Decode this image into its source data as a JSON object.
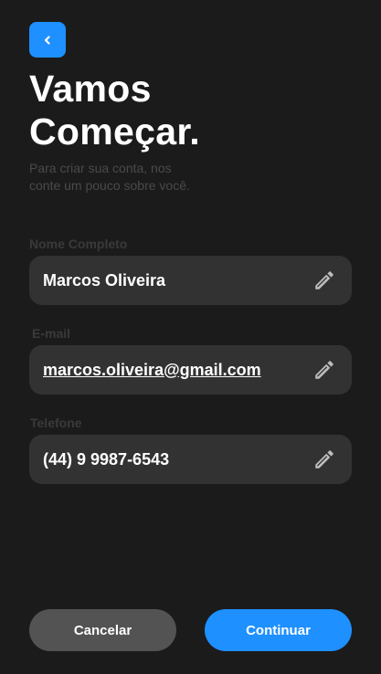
{
  "header": {
    "back_icon": "chevron-left-icon",
    "title_line1": "Vamos",
    "title_line2": "Começar.",
    "subtitle_line1": "Para criar sua conta, nos",
    "subtitle_line2": "conte um pouco sobre você."
  },
  "form": {
    "name": {
      "label": "Nome Completo",
      "value": "Marcos Oliveira",
      "icon": "pencil-icon"
    },
    "email": {
      "label": "E-mail",
      "value": "marcos.oliveira@gmail.com",
      "icon": "pencil-icon"
    },
    "phone": {
      "label": "Telefone",
      "value": "(44) 9 9987-6543",
      "icon": "pencil-icon"
    }
  },
  "actions": {
    "cancel_label": "Cancelar",
    "continue_label": "Continuar"
  },
  "colors": {
    "background": "#1b1b1b",
    "accent": "#1e90ff",
    "field_bg": "#323232",
    "cancel_bg": "#535353",
    "muted_text": "#4a4a4a"
  }
}
